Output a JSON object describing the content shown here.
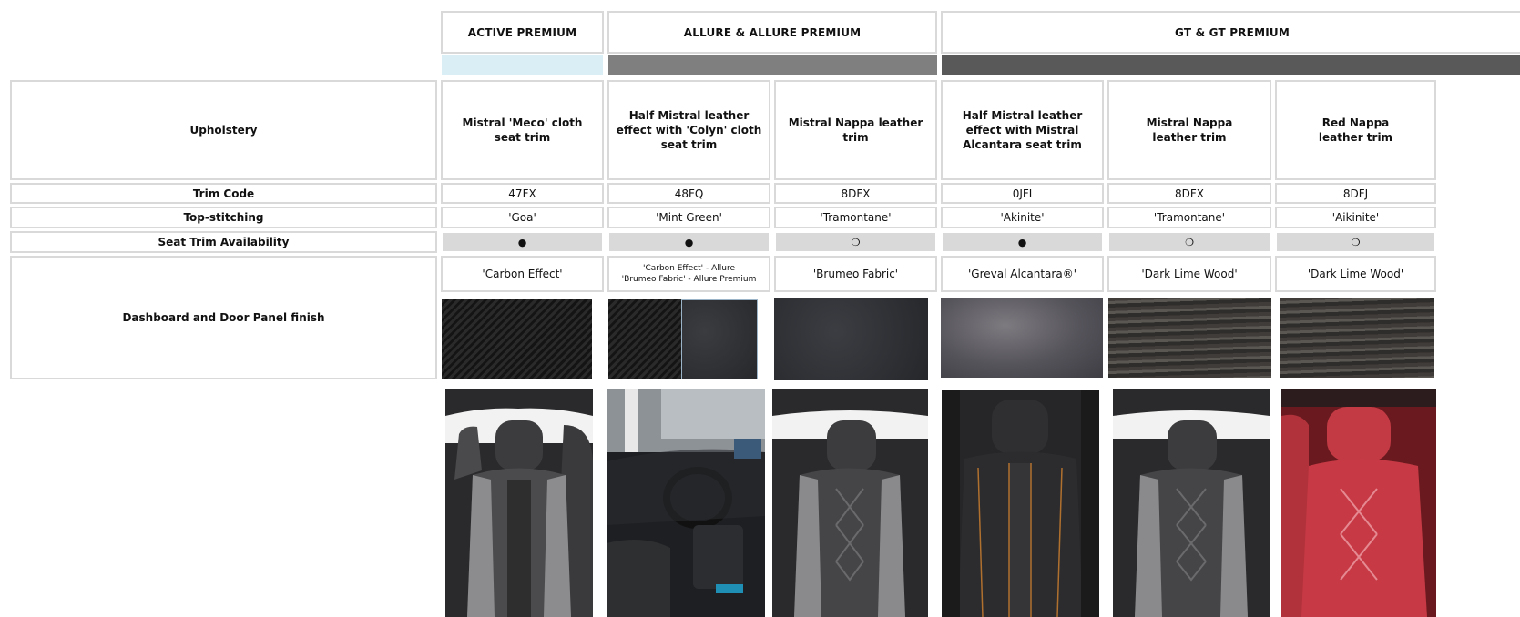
{
  "columns": {
    "headers": [
      "ACTIVE PREMIUM",
      "ALLURE & ALLURE PREMIUM",
      "GT & GT PREMIUM"
    ],
    "band_colors": [
      "#daeef5",
      "#7f7f7f",
      "#595959"
    ]
  },
  "rows": {
    "upholstery_label": "Upholstery",
    "trim_code_label": "Trim Code",
    "topstitch_label": "Top-stitching",
    "avail_label": "Seat Trim Availability",
    "dashboard_label": "Dashboard and Door Panel finish"
  },
  "trims": [
    {
      "upholstery": "Mistral 'Meco' cloth seat trim",
      "code": "47FX",
      "stitch": "'Goa'",
      "avail": "●",
      "dashboard": "'Carbon Effect'"
    },
    {
      "upholstery": "Half Mistral leather effect with 'Colyn' cloth seat trim",
      "code": "48FQ",
      "stitch": "'Mint Green'",
      "avail": "●",
      "dashboard": "'Carbon Effect' - Allure\n'Brumeo Fabric' - Allure Premium"
    },
    {
      "upholstery": "Mistral Nappa leather trim",
      "code": "8DFX",
      "stitch": "'Tramontane'",
      "avail": "❍",
      "dashboard": "'Brumeo Fabric'"
    },
    {
      "upholstery": "Half Mistral leather effect with Mistral Alcantara seat trim",
      "code": "0JFI",
      "stitch": "'Akinite'",
      "avail": "●",
      "dashboard": "'Greval Alcantara®'"
    },
    {
      "upholstery": "Mistral Nappa\nleather trim",
      "code": "8DFX",
      "stitch": "'Tramontane'",
      "avail": "❍",
      "dashboard": "'Dark Lime Wood'"
    },
    {
      "upholstery": "Red Nappa\nleather trim",
      "code": "8DFJ",
      "stitch": "'Aikinite'",
      "avail": "❍",
      "dashboard": "'Dark Lime Wood'"
    }
  ],
  "icons": {
    "standard": "filled-circle-icon",
    "option": "open-circle-icon",
    "swatches": [
      "carbon-effect-swatch",
      "carbon-effect-swatch",
      "brumeo-fabric-swatch",
      "brumeo-fabric-swatch",
      "greval-alcantara-swatch",
      "dark-lime-wood-swatch",
      "dark-lime-wood-swatch"
    ],
    "photos": [
      "grey-cloth-seat-photo",
      "interior-dashboard-photo",
      "quilted-nappa-seat-photo",
      "alcantara-seat-photo",
      "quilted-nappa-seat-photo",
      "red-nappa-seat-photo"
    ]
  }
}
